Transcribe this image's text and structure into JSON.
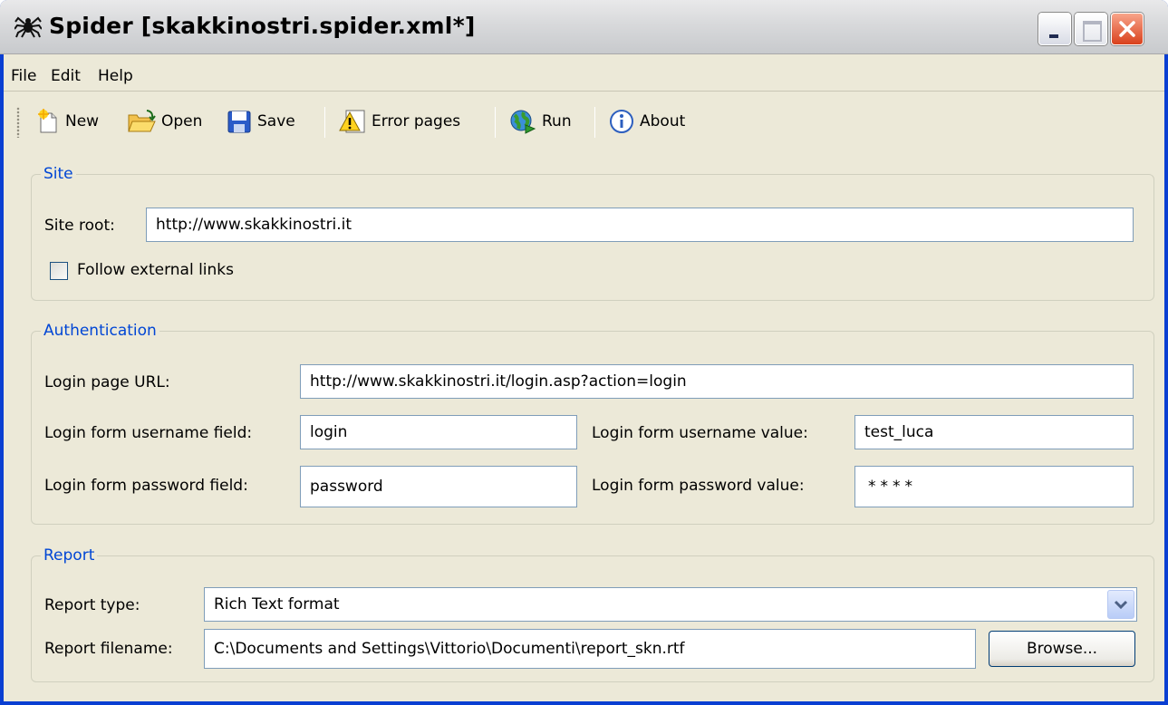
{
  "window": {
    "title": "Spider [skakkinostri.spider.xml*]"
  },
  "menu": {
    "items": [
      "File",
      "Edit",
      "Help"
    ]
  },
  "toolbar": {
    "new_label": "New",
    "open_label": "Open",
    "save_label": "Save",
    "error_pages_label": "Error pages",
    "run_label": "Run",
    "about_label": "About",
    "icons": [
      "new-document-icon",
      "open-folder-icon",
      "save-disk-icon",
      "warning-icon",
      "globe-run-icon",
      "info-icon"
    ]
  },
  "site": {
    "legend": "Site",
    "root_label": "Site root:",
    "root_value": "http://www.skakkinostri.it",
    "follow_external_label": "Follow external links",
    "follow_external_checked": false
  },
  "auth": {
    "legend": "Authentication",
    "login_url_label": "Login page URL:",
    "login_url_value": "http://www.skakkinostri.it/login.asp?action=login",
    "username_field_label": "Login form username field:",
    "username_field_value": "login",
    "username_value_label": "Login form username value:",
    "username_value": "test_luca",
    "password_field_label": "Login form password field:",
    "password_field_value": "password",
    "password_value_label": "Login form password value:",
    "password_value": "****"
  },
  "report": {
    "legend": "Report",
    "type_label": "Report type:",
    "type_value": "Rich Text format",
    "filename_label": "Report filename:",
    "filename_value": "C:\\Documents and Settings\\Vittorio\\Documenti\\report_skn.rtf",
    "browse_label": "Browse..."
  },
  "colors": {
    "legend": "#0046d5",
    "window_bg": "#ece9d8",
    "frame": "#0a3fd2"
  }
}
